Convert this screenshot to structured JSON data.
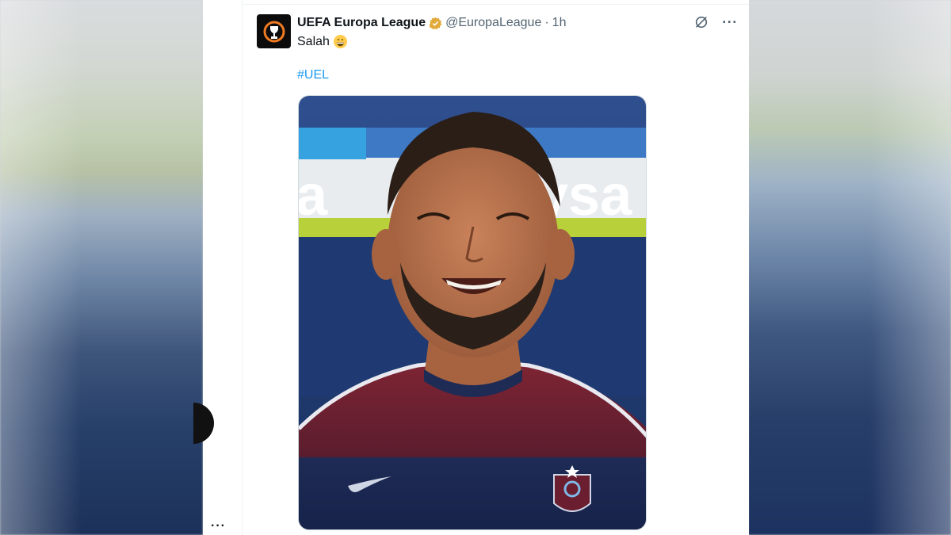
{
  "tweet": {
    "display_name": "UEFA Europa League",
    "handle": "@EuropaLeague",
    "separator": "·",
    "time": "1h",
    "text": "Salah",
    "hashtag": "#UEL",
    "verified_badge_color": "#e2a93b"
  },
  "icons": {
    "grok": "grok-icon",
    "more": "more-options-icon",
    "verified": "verified-badge-icon",
    "emoji": "grinning-face-emoji"
  },
  "ui": {
    "more_dots": "···",
    "bottom_more": "···"
  },
  "colors": {
    "link": "#1d9bf0",
    "text": "#0f1419",
    "secondary": "#536471"
  }
}
